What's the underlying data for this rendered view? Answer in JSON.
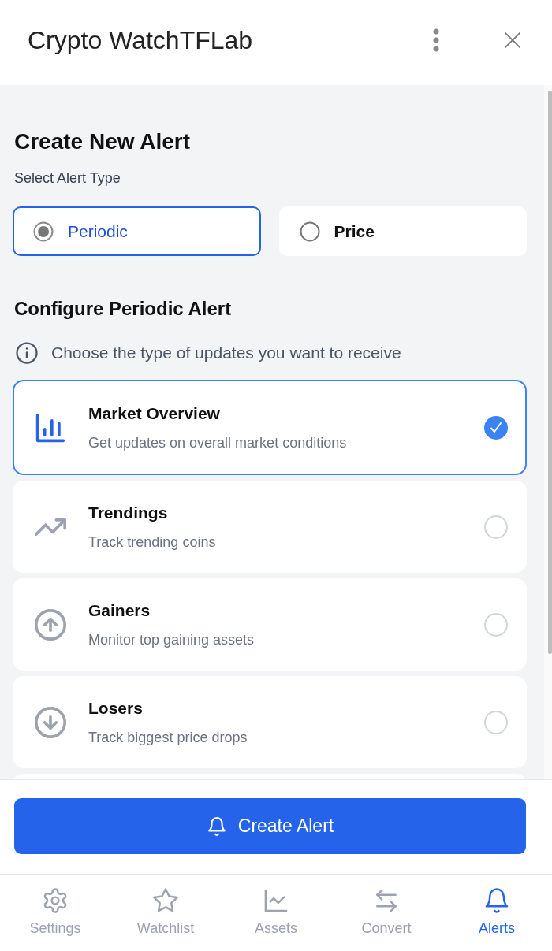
{
  "header": {
    "title": "Crypto WatchTFLab"
  },
  "form": {
    "heading": "Create New Alert",
    "type_label": "Select Alert Type",
    "alert_types": [
      {
        "label": "Periodic",
        "selected": true
      },
      {
        "label": "Price",
        "selected": false
      }
    ],
    "section_title": "Configure Periodic Alert",
    "hint": "Choose the type of updates you want to receive",
    "options": [
      {
        "kind": "bar-chart",
        "title": "Market Overview",
        "description": "Get updates on overall market conditions",
        "selected": true
      },
      {
        "kind": "trend-up",
        "title": "Trendings",
        "description": "Track trending coins",
        "selected": false
      },
      {
        "kind": "arrow-up",
        "title": "Gainers",
        "description": "Monitor top gaining assets",
        "selected": false
      },
      {
        "kind": "arrow-down",
        "title": "Losers",
        "description": "Track biggest price drops",
        "selected": false
      }
    ]
  },
  "create_button": {
    "label": "Create Alert"
  },
  "bottom_nav": [
    {
      "kind": "gear",
      "label": "Settings",
      "selected": false
    },
    {
      "kind": "star",
      "label": "Watchlist",
      "selected": false
    },
    {
      "kind": "line-chart",
      "label": "Assets",
      "selected": false
    },
    {
      "kind": "swap",
      "label": "Convert",
      "selected": false
    },
    {
      "kind": "bell",
      "label": "Alerts",
      "selected": true
    }
  ]
}
